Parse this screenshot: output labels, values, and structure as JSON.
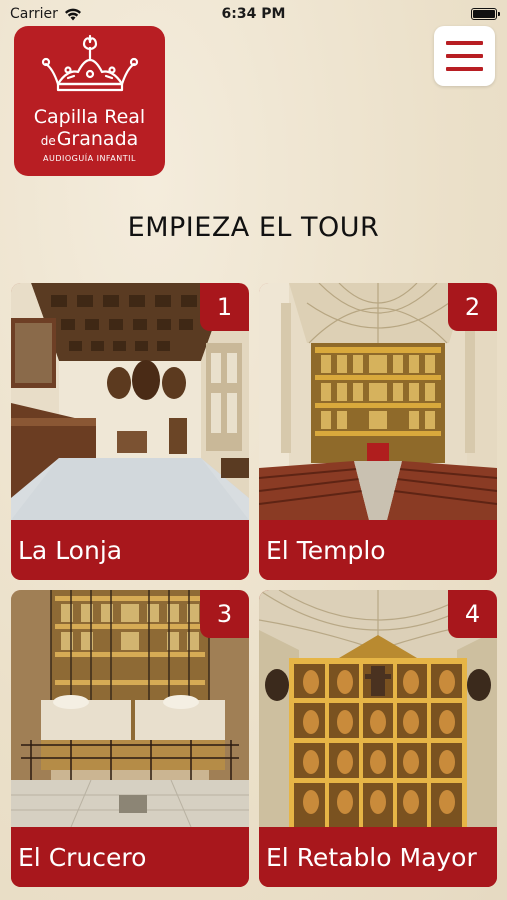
{
  "status_bar": {
    "carrier": "Carrier",
    "time": "6:34 PM"
  },
  "logo": {
    "line1": "Capilla Real",
    "line2_prefix": "de",
    "line2": "Granada",
    "subtitle": "AUDIOGUÍA INFANTIL"
  },
  "section_title": "EMPIEZA EL TOUR",
  "colors": {
    "brand_red": "#b81e23",
    "background": "#efe6d2"
  },
  "tour_items": [
    {
      "number": "1",
      "label": "La Lonja"
    },
    {
      "number": "2",
      "label": "El Templo"
    },
    {
      "number": "3",
      "label": "El Crucero"
    },
    {
      "number": "4",
      "label": "El Retablo Mayor"
    }
  ]
}
